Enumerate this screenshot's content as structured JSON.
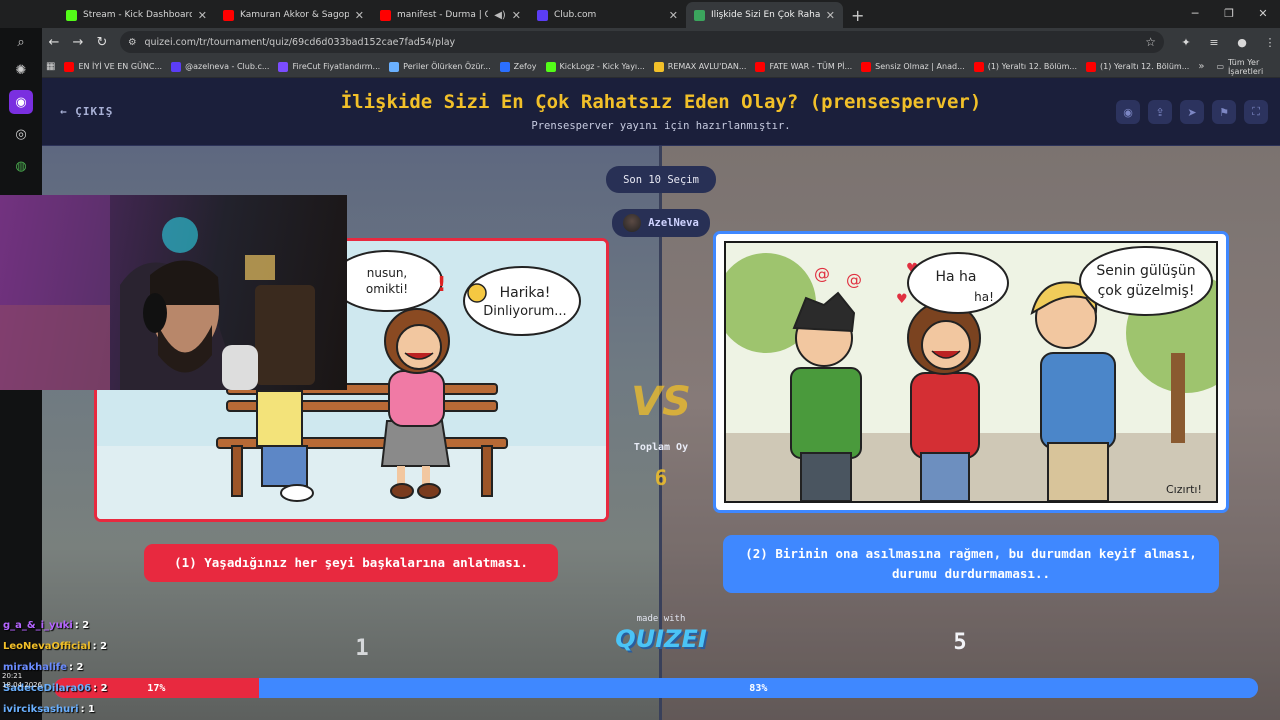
{
  "browser": {
    "tabs": [
      {
        "label": "Stream - Kick Dashboard",
        "color": "#53fc18",
        "active": false
      },
      {
        "label": "Kamuran Akkor & Sagopa Kajmer",
        "color": "#ff0000",
        "active": false
      },
      {
        "label": "manifest - Durma | Official",
        "color": "#ff0000",
        "active": false
      },
      {
        "label": "Club.com",
        "color": "#5b3df5",
        "active": false
      },
      {
        "label": "İlişkide Sizi En Çok Rahatsız Ede",
        "color": "#3ba55d",
        "active": true
      }
    ],
    "url": "quizei.com/tr/tournament/quiz/69cd6d033bad152cae7fad54/play",
    "bookmarks": [
      {
        "label": "EN İYİ VE EN GÜNC...",
        "color": "#ff0000"
      },
      {
        "label": "@azelneva - Club.c...",
        "color": "#5b3df5"
      },
      {
        "label": "FireCut Fiyatlandırm...",
        "color": "#7b4cff"
      },
      {
        "label": "Periler Ölürken Özür...",
        "color": "#6ab0ff"
      },
      {
        "label": "Zefoy",
        "color": "#2b6fff"
      },
      {
        "label": "KickLogz - Kick Yayı...",
        "color": "#53fc18"
      },
      {
        "label": "REMAX AVLU'DAN...",
        "color": "#f2c029"
      },
      {
        "label": "FATE WAR - TÜM Pİ...",
        "color": "#ff0000"
      },
      {
        "label": "Sensiz Olmaz | Anad...",
        "color": "#ff0000"
      },
      {
        "label": "(1) Yeraltı 12. Bölüm...",
        "color": "#ff0000"
      },
      {
        "label": "(1) Yeraltı 12. Bölüm...",
        "color": "#ff0000"
      }
    ],
    "all_bookmarks": "Tüm Yer İşaretleri"
  },
  "quiz": {
    "exit_label": "ÇIKIŞ",
    "title": "İlişkide Sizi En Çok Rahatsız Eden Olay? (prensesperver)",
    "subtitle": "Prensesperver yayını için hazırlanmıştır.",
    "last_selection": "Son 10 Seçim",
    "user": "AzelNeva",
    "vs": "VS",
    "total_label": "Toplam Oy",
    "total_value": "6",
    "made_with": "made with",
    "brand": "QUIZEI",
    "accent_left": "#e8293f",
    "accent_right": "#3f88ff"
  },
  "options": {
    "left": {
      "text": "(1) Yaşadığınız her şeyi başkalarına anlatması.",
      "votes": "1",
      "percent_label": "17%",
      "percent": 17,
      "bubble_partial": "nusun, omikti!",
      "bubble_girl": "Harika! Dinliyorum..."
    },
    "right": {
      "text": "(2) Birinin ona asılmasına rağmen, bu durumdan keyif alması, durumu durdurmaması..",
      "votes": "5",
      "percent_label": "83%",
      "percent": 83,
      "bubble_haha": "Ha ha ha!",
      "bubble_boy": "Senin gülüşün çok güzelmiş!",
      "sfx": "Cızırtı!"
    }
  },
  "chat": [
    {
      "name": "g_a_&_i_yuki",
      "count": ": 2",
      "color": "#b565ff"
    },
    {
      "name": "LeoNevaOfficial",
      "count": ": 2",
      "color": "#f2c029"
    },
    {
      "name": "mirakhalife",
      "count": ": 2",
      "color": "#6b8cff"
    },
    {
      "name": "SadeceDilara06",
      "count": ": 2",
      "color": "#6ab0ff"
    },
    {
      "name": "ivirciksashuri",
      "count": ": 1",
      "color": "#6ab0ff"
    }
  ],
  "clock": {
    "time": "20:21",
    "date": "18.04.2026"
  }
}
